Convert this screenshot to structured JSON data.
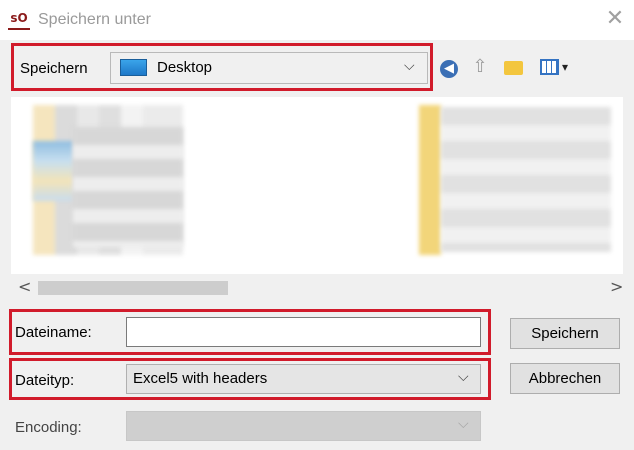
{
  "window": {
    "icon_text": "sO",
    "title": "Speichern unter",
    "close_glyph": "✕"
  },
  "toolbar": {
    "location_label": "Speichern",
    "location_value": "Desktop",
    "location_icon": "desktop-icon",
    "chevron": "⌵",
    "icons": [
      "back-icon",
      "up-folder-icon",
      "new-folder-icon",
      "view-menu-icon"
    ]
  },
  "scroll": {
    "left_arrow": "<",
    "right_arrow": ">"
  },
  "form": {
    "filename_label": "Dateiname:",
    "filename_value": "",
    "filetype_label": "Dateityp:",
    "filetype_value": "Excel5 with headers",
    "encoding_label": "Encoding:",
    "encoding_value": ""
  },
  "buttons": {
    "save": "Speichern",
    "cancel": "Abbrechen"
  },
  "colors": {
    "highlight": "#d11b2b",
    "dialog_bg": "#f0f0f0"
  }
}
